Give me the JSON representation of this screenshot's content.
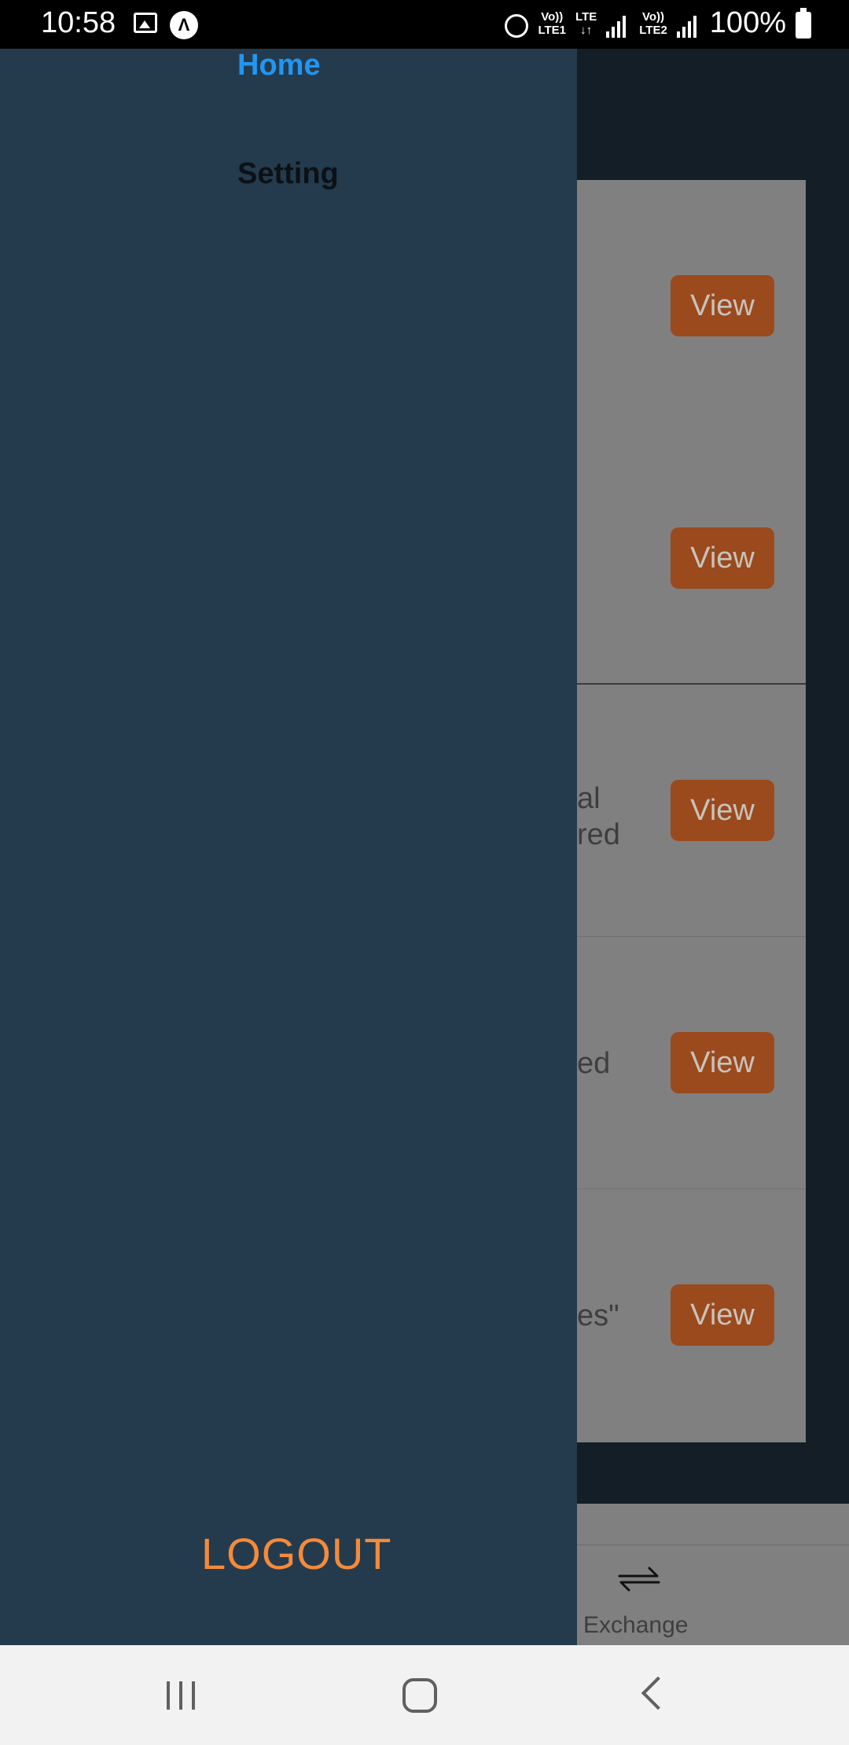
{
  "status_bar": {
    "time": "10:58",
    "net1_top": "Vo))",
    "net1_bottom": "LTE1",
    "net_mid_top": "LTE",
    "net_mid_bottom": "↓↑",
    "net2_top": "Vo))",
    "net2_bottom": "LTE2",
    "battery_text": "100%",
    "app_icon_letter": "Λ"
  },
  "drawer": {
    "items": [
      {
        "label": "Home",
        "active": true
      },
      {
        "label": "Setting",
        "active": false
      }
    ],
    "logout_label": "LOGOUT"
  },
  "background": {
    "rows": [
      {
        "view_label": "View",
        "fragment_lines": []
      },
      {
        "view_label": "View",
        "fragment_lines": []
      },
      {
        "view_label": "View",
        "fragment_lines": [
          "al",
          " red"
        ]
      },
      {
        "view_label": "View",
        "fragment_lines": [
          "ed"
        ]
      },
      {
        "view_label": "View",
        "fragment_lines": [
          "es\""
        ]
      }
    ],
    "bottom_tab": {
      "label": "Exchange",
      "icon": "exchange-icon"
    }
  },
  "colors": {
    "drawer_bg": "#243b4d",
    "active_item": "#2196f3",
    "logout": "#f58a3a",
    "view_button": "#9a4a1d"
  }
}
